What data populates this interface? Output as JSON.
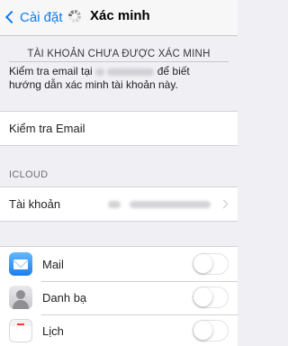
{
  "nav": {
    "back_label": "Cài đặt",
    "title": "Xác minh"
  },
  "verify": {
    "header": "TÀI KHOẢN CHƯA ĐƯỢC XÁC MINH",
    "desc_line1_prefix": "Kiểm tra email tại",
    "desc_line1_suffix": "để biết",
    "desc_line2": "hướng dẫn xác minh tài khoản này."
  },
  "check_email_label": "Kiểm tra Email",
  "icloud": {
    "group_label": "ICLOUD",
    "account_label": "Tài khoản"
  },
  "apps": [
    {
      "name": "Mail",
      "icon": "mail-icon",
      "enabled": false
    },
    {
      "name": "Danh bạ",
      "icon": "contacts-icon",
      "enabled": false
    },
    {
      "name": "Lịch",
      "icon": "calendar-icon",
      "enabled": false
    }
  ],
  "colors": {
    "tint": "#0a7cf6",
    "background": "#efeff4"
  }
}
